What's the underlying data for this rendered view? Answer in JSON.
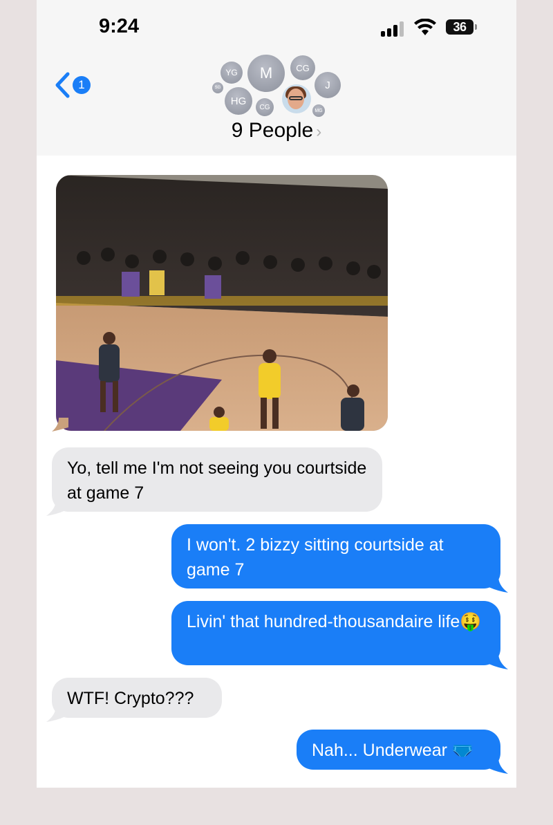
{
  "status_bar": {
    "time": "9:24",
    "battery": "36"
  },
  "header": {
    "back_badge": "1",
    "avatars": [
      "YG",
      "M",
      "CG",
      "J",
      "SG",
      "HG",
      "CG",
      "MG"
    ],
    "group_name": "9 People",
    "chevron": "›"
  },
  "messages": [
    {
      "from": "them",
      "text": "Yo, tell me I'm not seeing you courtside at game 7"
    },
    {
      "from": "me",
      "text": "I won't. 2 bizzy sitting courtside at game 7"
    },
    {
      "from": "me",
      "text": "Livin' that hundred-thousandaire life🤑"
    },
    {
      "from": "them",
      "text": "WTF! Crypto???"
    },
    {
      "from": "me",
      "text": "Nah... Underwear 🩲"
    }
  ],
  "colors": {
    "accent": "#1a7ef7",
    "incoming_bubble": "#e9e9eb",
    "header_bg": "#f6f6f6"
  }
}
